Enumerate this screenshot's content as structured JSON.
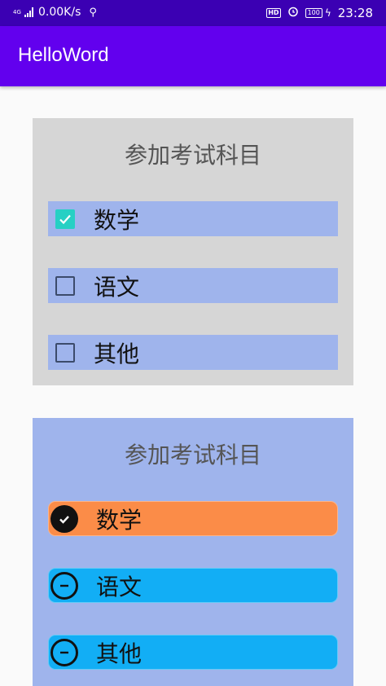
{
  "status_bar": {
    "network": "4G",
    "speed": "0.00K/s",
    "usb_icon": "usb-icon",
    "hd": "HD",
    "alarm_icon": "alarm-clock-icon",
    "battery": "100",
    "time": "23:28"
  },
  "app_bar": {
    "title": "HelloWord"
  },
  "checkbox_group": {
    "title": "参加考试科目",
    "items": [
      {
        "label": "数学",
        "checked": true
      },
      {
        "label": "语文",
        "checked": false
      },
      {
        "label": "其他",
        "checked": false
      }
    ],
    "colors": {
      "panel": "#d6d6d6",
      "row": "#9fb4ec",
      "check": "#26d0c4"
    }
  },
  "radio_group": {
    "title": "参加考试科目",
    "items": [
      {
        "label": "数学",
        "selected": true,
        "color": "#fb8c48"
      },
      {
        "label": "语文",
        "selected": false,
        "color": "#12aef5"
      },
      {
        "label": "其他",
        "selected": false,
        "color": "#12aef5"
      }
    ],
    "colors": {
      "panel": "#9fb4ec"
    }
  },
  "colors": {
    "status_bar": "#3b00b3",
    "app_bar": "#6200ee"
  }
}
